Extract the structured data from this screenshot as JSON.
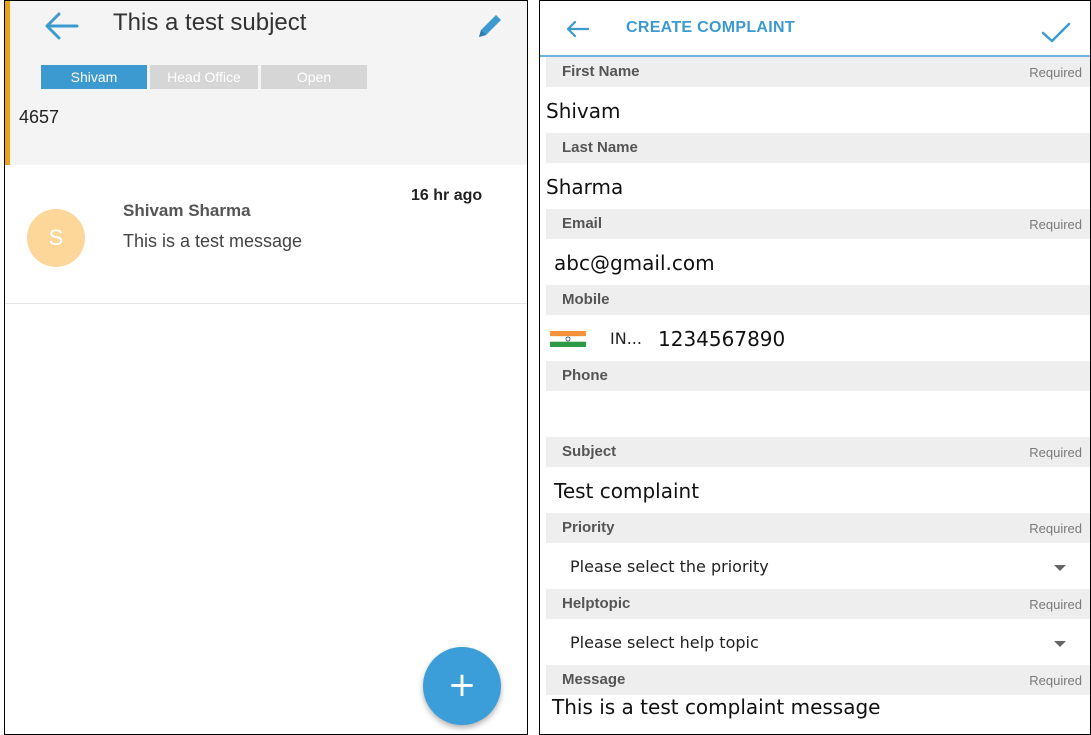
{
  "ticket": {
    "subject": "This a test subject",
    "tags": {
      "user": "Shivam",
      "department": "Head Office",
      "status": "Open"
    },
    "number": "4657",
    "accent_color": "#e8a317"
  },
  "message": {
    "avatar_letter": "S",
    "sender": "Shivam Sharma",
    "text": "This is a test message",
    "time": "16 hr ago"
  },
  "fab": {
    "icon": "plus-icon",
    "label": "+"
  },
  "form": {
    "title": "CREATE COMPLAINT",
    "required_text": "Required",
    "fields": {
      "first_name": {
        "label": "First Name",
        "value": "Shivam"
      },
      "last_name": {
        "label": "Last Name",
        "value": "Sharma"
      },
      "email": {
        "label": "Email",
        "value": "abc@gmail.com"
      },
      "mobile": {
        "label": "Mobile",
        "country_code": "IN...",
        "value": "1234567890"
      },
      "phone": {
        "label": "Phone",
        "value": ""
      },
      "subject": {
        "label": "Subject",
        "value": "Test complaint"
      },
      "priority": {
        "label": "Priority",
        "value": "Please select the priority"
      },
      "helptopic": {
        "label": "Helptopic",
        "value": "Please select help topic"
      },
      "message": {
        "label": "Message",
        "value": "This is a test complaint message"
      }
    }
  },
  "colors": {
    "primary": "#3d9ad1",
    "fab": "#3b9ed8",
    "avatar": "#fdd69a"
  }
}
